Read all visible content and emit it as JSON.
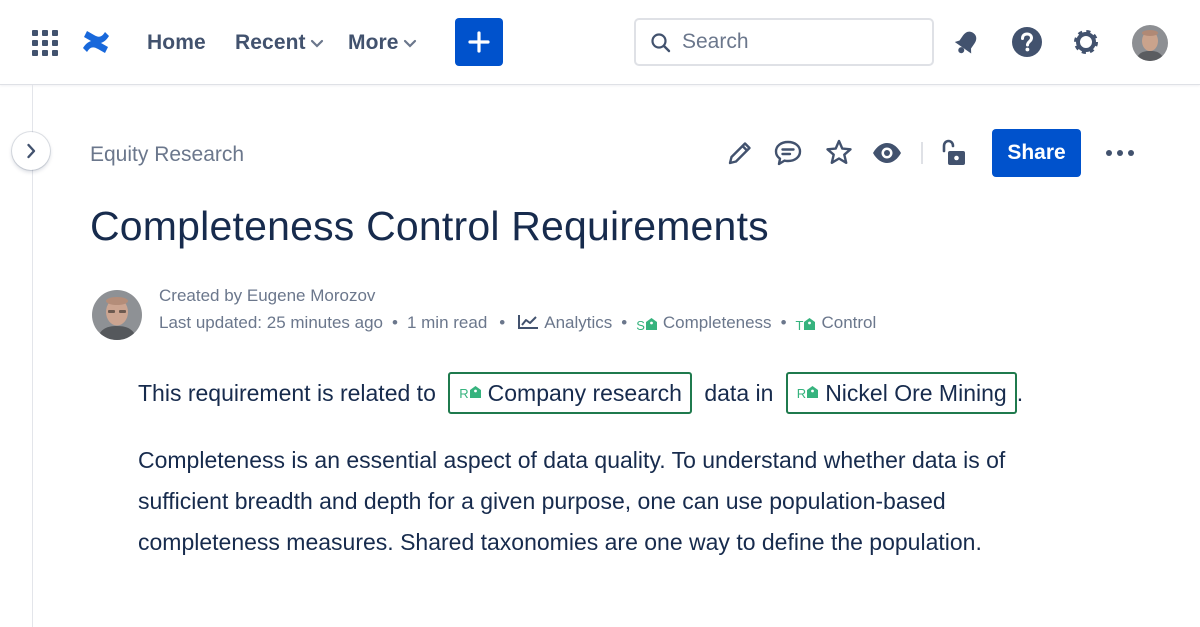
{
  "nav": {
    "home": "Home",
    "recent": "Recent",
    "more": "More",
    "search_placeholder": "Search"
  },
  "page": {
    "breadcrumb": "Equity Research",
    "share_label": "Share",
    "title": "Completeness Control Requirements"
  },
  "byline": {
    "created": "Created by Eugene Morozov",
    "updated": "Last updated: 25 minutes ago",
    "read_time": "1 min read",
    "labels": [
      {
        "prefix": "",
        "text": "Analytics"
      },
      {
        "prefix": "S",
        "text": "Completeness"
      },
      {
        "prefix": "T",
        "text": "Control"
      }
    ]
  },
  "body": {
    "p1_pre": "This requirement is related to",
    "p1_ref1_prefix": "R",
    "p1_ref1": "Company research",
    "p1_mid": "data in",
    "p1_ref2_prefix": "R",
    "p1_ref2": "Nickel Ore Mining",
    "p1_end": ".",
    "p2": "Completeness is an essential aspect of data quality. To understand whether data is of sufficient breadth and depth for a given purpose, one can use population-based completeness measures. Shared taxonomies are one way to define the population."
  },
  "colors": {
    "primary": "#0052cc",
    "text": "#172b4d",
    "subtle": "#6b778c",
    "icon": "#42526e",
    "tag_green": "#36b37e",
    "ref_border": "#1f7a4d"
  },
  "icons": [
    "app-switcher-icon",
    "confluence-logo",
    "chevron-down-icon",
    "plus-icon",
    "search-icon",
    "notification-icon",
    "help-icon",
    "settings-icon",
    "chevron-right-icon",
    "edit-icon",
    "comment-icon",
    "star-icon",
    "watch-icon",
    "unlock-icon",
    "more-icon",
    "chart-icon",
    "tag-icon"
  ]
}
